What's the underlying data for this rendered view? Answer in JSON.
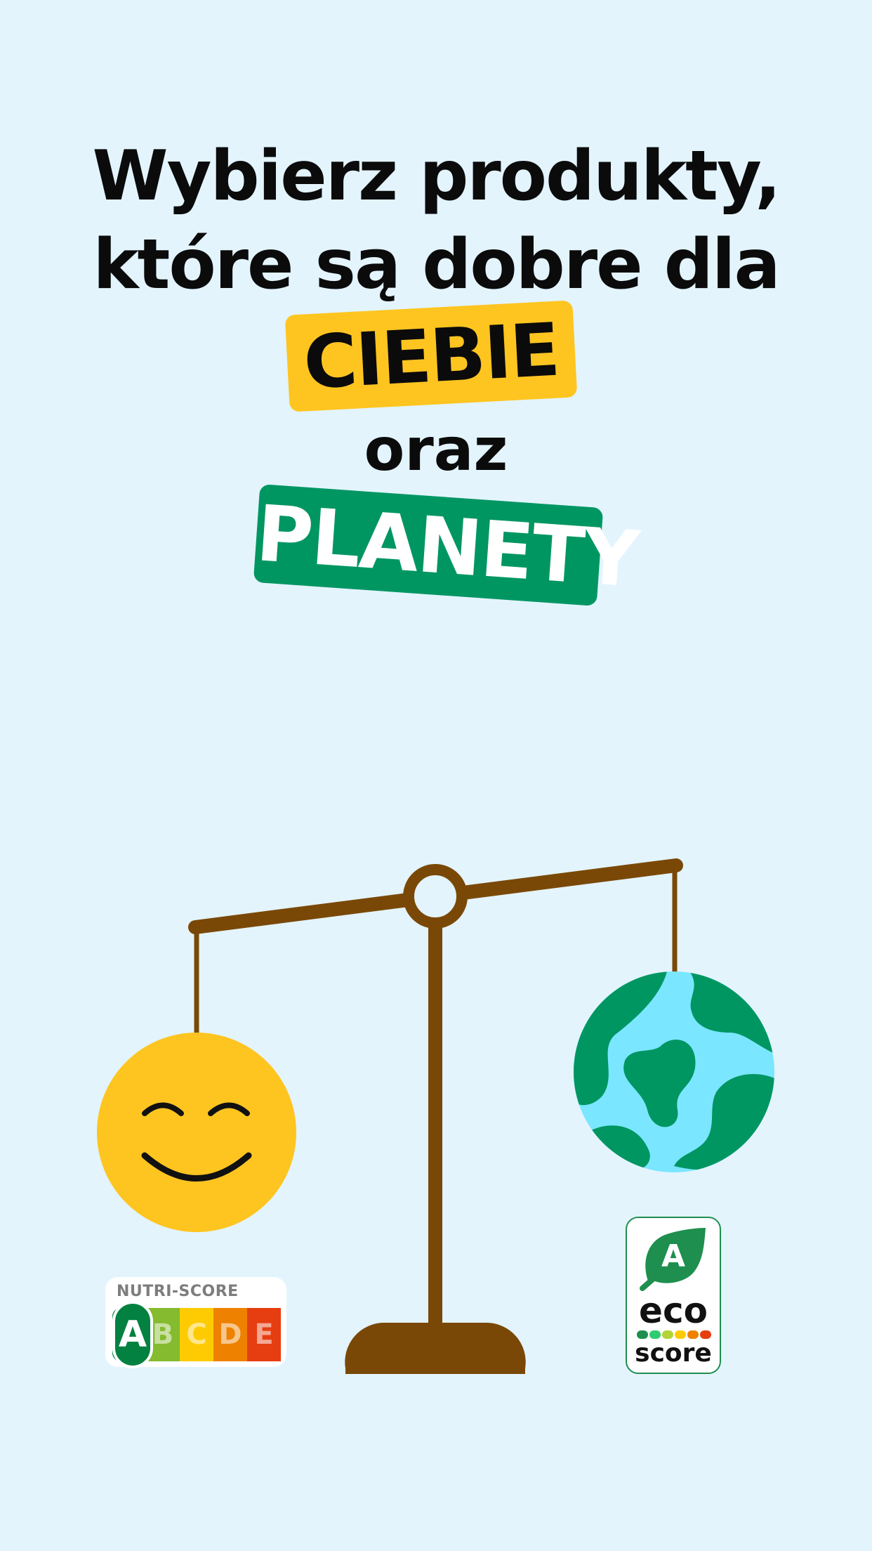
{
  "headline": {
    "line1": "Wybierz produkty,",
    "line2": "które są dobre dla",
    "tag_you": "CIEBIE",
    "conjunction": "oraz",
    "tag_planet": "PLANETY"
  },
  "nutri_score": {
    "title": "NUTRI-SCORE",
    "grades": [
      "A",
      "B",
      "C",
      "D",
      "E"
    ],
    "active_grade": "A",
    "colors": [
      "#038141",
      "#85bb2f",
      "#fecb02",
      "#ee8100",
      "#e63e11"
    ]
  },
  "eco_score": {
    "grade": "A",
    "word_top": "eco",
    "word_bottom": "score",
    "colors": [
      "#1e8f4e",
      "#2ecc71",
      "#b4d335",
      "#fecb02",
      "#ee8100",
      "#e63e11"
    ]
  },
  "colors": {
    "background": "#e3f4fd",
    "yellow": "#fec520",
    "green": "#009662",
    "scale_brown": "#7a4806",
    "globe_ocean": "#7ae6ff"
  },
  "icons": [
    "smiley-face-icon",
    "earth-globe-icon",
    "balance-scale-icon"
  ]
}
